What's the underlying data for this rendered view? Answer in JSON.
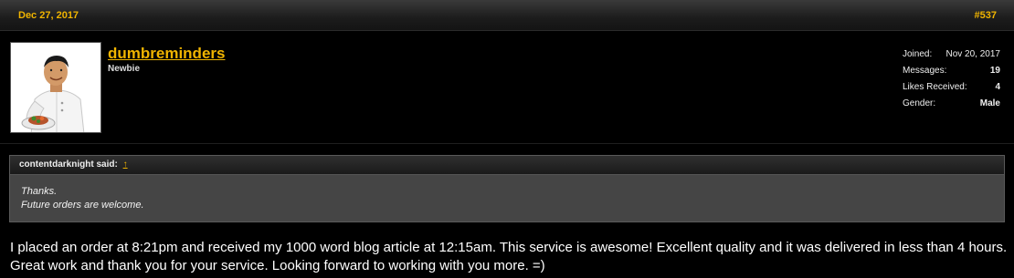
{
  "post": {
    "date": "Dec 27, 2017",
    "number": "#537"
  },
  "user": {
    "name": "dumbreminders",
    "title": "Newbie",
    "stats": [
      {
        "label": "Joined:",
        "value": "Nov 20, 2017"
      },
      {
        "label": "Messages:",
        "value": "19"
      },
      {
        "label": "Likes Received:",
        "value": "4"
      },
      {
        "label": "Gender:",
        "value": "Male"
      }
    ]
  },
  "quote": {
    "author_said": "contentdarknight said:",
    "arrow": "↑",
    "lines": [
      "Thanks.",
      "Future orders are welcome."
    ]
  },
  "message": "I placed an order at 8:21pm and received my 1000 word blog article at 12:15am. This service is awesome! Excellent quality and it was delivered in less than 4 hours. Great work and thank you for your service. Looking forward to working with you more. =)",
  "colors": {
    "accent": "#f0b400",
    "background": "#000000",
    "quote_bg": "#454545"
  }
}
